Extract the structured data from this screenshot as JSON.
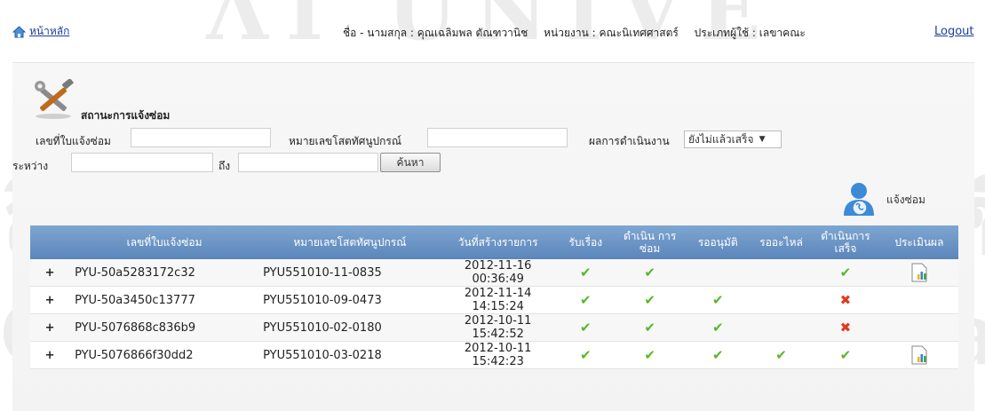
{
  "header": {
    "home_label": "หน้าหลัก",
    "name_label": "ชื่อ - นามสกุล : คุณเฉลิมพล ตัณฑวานิช",
    "unit_label": "หน่วยงาน : คณะนิเทศศาสตร์",
    "usertype_label": "ประเภทผู้ใช้ : เลขาคณะ",
    "logout_label": "Logout"
  },
  "section": {
    "title": "สถานะการแจ้งซ่อม"
  },
  "filters": {
    "ticket_label": "เลขที่ใบแจ้งซ่อม",
    "ticket_value": "",
    "asset_label": "หมายเลขโสตทัศนูปกรณ์",
    "asset_value": "",
    "result_label": "ผลการดำเนินงาน",
    "result_selected": "ยังไม่แล้วเสร็จ",
    "between_label": "ระหว่าง",
    "from_value": "",
    "to_label": "ถึง",
    "to_value": "",
    "search_button": "ค้นหา"
  },
  "notify": {
    "label": "แจ้งซ่อม"
  },
  "table": {
    "headers": [
      "เลขที่ใบแจ้งซ่อม",
      "หมายเลขโสตทัศนูปกรณ์",
      "วันที่สร้างรายการ",
      "รับเรื่อง",
      "ดำเนิน การซ่อม",
      "รออนุมัติ",
      "รออะไหล่",
      "ดำเนินการ เสร็จ",
      "ประเมินผล"
    ],
    "rows": [
      {
        "expand": "+",
        "ticket": "PYU-50a5283172c32",
        "asset": "PYU551010-11-0835",
        "date1": "2012-11-16",
        "date2": "00:36:49",
        "received": "✔",
        "repairing": "✔",
        "approval": "",
        "parts": "",
        "done": "✔",
        "done_status": "check",
        "evaluate": true
      },
      {
        "expand": "+",
        "ticket": "PYU-50a3450c13777",
        "asset": "PYU551010-09-0473",
        "date1": "2012-11-14",
        "date2": "14:15:24",
        "received": "✔",
        "repairing": "✔",
        "approval": "✔",
        "parts": "",
        "done": "✖",
        "done_status": "cross",
        "evaluate": false
      },
      {
        "expand": "+",
        "ticket": "PYU-5076868c836b9",
        "asset": "PYU551010-02-0180",
        "date1": "2012-10-11",
        "date2": "15:42:52",
        "received": "✔",
        "repairing": "✔",
        "approval": "✔",
        "parts": "",
        "done": "✖",
        "done_status": "cross",
        "evaluate": false
      },
      {
        "expand": "+",
        "ticket": "PYU-5076866f30dd2",
        "asset": "PYU551010-03-0218",
        "date1": "2012-10-11",
        "date2": "15:42:23",
        "received": "✔",
        "repairing": "✔",
        "approval": "✔",
        "parts": "✔",
        "done": "✔",
        "done_status": "check",
        "evaluate": true
      }
    ]
  },
  "colors": {
    "header_gradient_top": "#7ea6d1",
    "header_gradient_bottom": "#5b86bb",
    "check": "#55b82a",
    "cross": "#e03a1f",
    "link": "#1a3ea0"
  }
}
